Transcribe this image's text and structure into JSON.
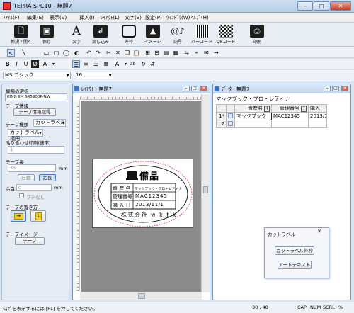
{
  "window": {
    "title": "TEPRA SPC10 - 無題7"
  },
  "menu": [
    "ﾌｧｲﾙ(F)",
    "編集(E)",
    "表示(V)",
    "挿入(I)",
    "ﾚｲｱｳﾄ(L)",
    "文字(S)",
    "設定(P)",
    "ｳｨﾝﾄﾞｳ(W)",
    "ﾍﾙﾌﾟ(H)"
  ],
  "toolbar": {
    "new_open": "新規 / 開く",
    "save": "保存",
    "text": "文字",
    "flow": "流し込み",
    "frame": "外枠",
    "image": "イメージ",
    "symbol": "記号",
    "barcode": "バーコード",
    "qr": "QRコード",
    "print": "印刷"
  },
  "font": {
    "name": "MS ゴシック",
    "size": "16"
  },
  "left_panel": {
    "model_label": "機種の選択",
    "model_value": "KING JIM SR5900P-NW",
    "tape_info_label": "テープ情報",
    "tape_info_button": "テープ情報取得",
    "tape_type_label": "テープ種類",
    "tape_type_value": "カットラベル",
    "tape_subtype_value": "カットラベル 楕円",
    "match_print_label": "貼り合わせ印刷(倍率)",
    "match_print_value": "1",
    "tape_length_label": "テープ長",
    "tape_length_value": "35",
    "tape_length_unit": "mm",
    "auto_button": "自動",
    "fixed_button": "定長",
    "margin_label": "余白",
    "margin_value": "0",
    "margin_unit": "mm",
    "margin_check": "フチなし",
    "direction_label": "テープの置き方",
    "tape_image_label": "テープイメージ",
    "tape_button": "テープ"
  },
  "layout_window": {
    "title": "ﾚｲｱｳﾄ - 無題7"
  },
  "label": {
    "heading": "備品",
    "row_labels": [
      "資 産 名",
      "管理番号",
      "購 入 日"
    ],
    "row_values": [
      "マックブック・プロ・レティナ",
      "MAC12345",
      "2013/11/1"
    ],
    "company": "株式会社 w k t k"
  },
  "data_window": {
    "title": "ﾃﾞｰﾀ - 無題7",
    "current_value": "マックブック・プロ・レティナ",
    "headers": [
      "資産名",
      "管理番号",
      "購入"
    ],
    "rows": [
      {
        "num": "1",
        "name": "マックブック",
        "code": "MAC12345",
        "date": "2013/1"
      },
      {
        "num": "2",
        "name": "",
        "code": "",
        "date": ""
      }
    ]
  },
  "popup": {
    "title": "カットラベル",
    "close": "✕",
    "btn1": "カットラベル外枠",
    "btn2": "アートテキスト"
  },
  "status": {
    "help": "ﾍﾙﾌﾟを表示するには [F1] を押してください。",
    "coords": "30 , 48",
    "caps": "CAP",
    "num": "NUM",
    "scrl": "SCRL",
    "zoom": "%"
  }
}
